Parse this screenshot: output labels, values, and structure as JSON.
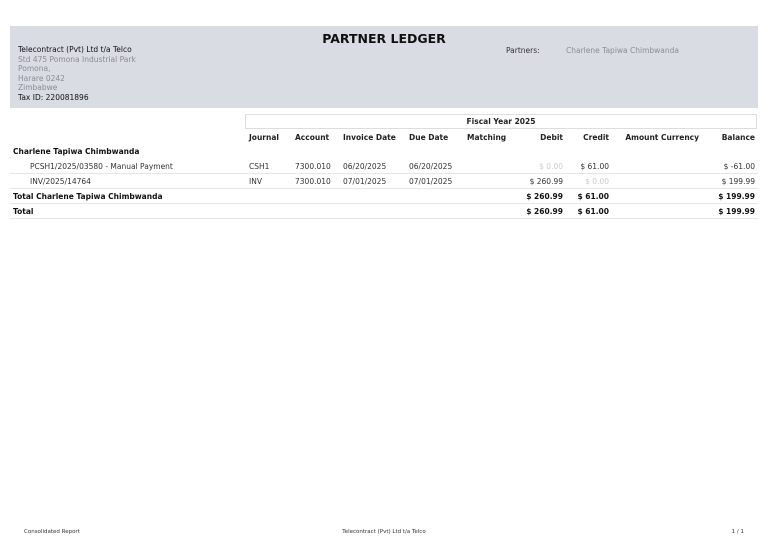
{
  "title": "PARTNER LEDGER",
  "company": {
    "name": "Telecontract (Pvt) Ltd t/a Telco",
    "address": [
      "Std 475 Pomona Industrial Park",
      "Pomona,",
      "Harare 0242",
      "Zimbabwe"
    ],
    "tax_id": "Tax ID: 220081896"
  },
  "filters": {
    "partners_label": "Partners:",
    "partners_value": "Charlene Tapiwa Chimbwanda"
  },
  "period": "Fiscal Year 2025",
  "columns": [
    "Journal",
    "Account",
    "Invoice Date",
    "Due Date",
    "Matching",
    "Debit",
    "Credit",
    "Amount Currency",
    "Balance"
  ],
  "partner": {
    "name": "Charlene Tapiwa Chimbwanda",
    "lines": [
      {
        "ref": "PCSH1/2025/03580 - Manual Payment",
        "journal": "CSH1",
        "account": "7300.010",
        "invoice_date": "06/20/2025",
        "due_date": "06/20/2025",
        "matching": "",
        "debit": "$ 0.00",
        "credit": "$ 61.00",
        "amount_currency": "",
        "balance": "$ -61.00"
      },
      {
        "ref": "INV/2025/14764",
        "journal": "INV",
        "account": "7300.010",
        "invoice_date": "07/01/2025",
        "due_date": "07/01/2025",
        "matching": "",
        "debit": "$ 260.99",
        "credit": "$ 0.00",
        "amount_currency": "",
        "balance": "$ 199.99"
      }
    ],
    "total": {
      "label": "Total Charlene Tapiwa Chimbwanda",
      "debit": "$ 260.99",
      "credit": "$ 61.00",
      "balance": "$ 199.99"
    }
  },
  "grand_total": {
    "label": "Total",
    "debit": "$ 260.99",
    "credit": "$ 61.00",
    "balance": "$ 199.99"
  },
  "footer": {
    "left": "Consolidated Report",
    "center": "Telecontract (Pvt) Ltd t/a Telco",
    "page": "1 / 1"
  }
}
